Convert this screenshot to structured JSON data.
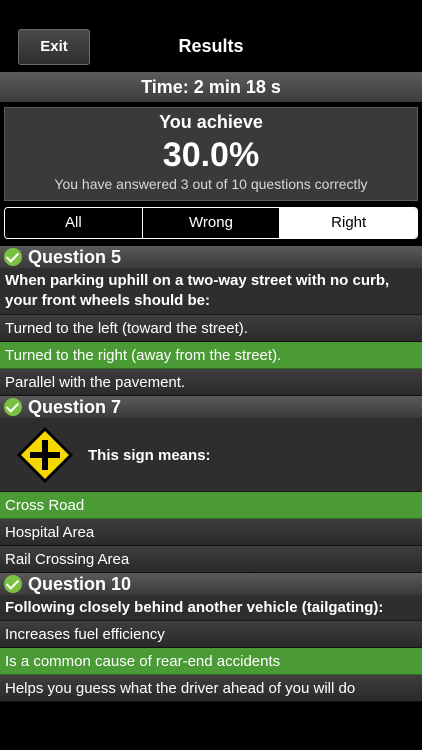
{
  "navbar": {
    "exit_label": "Exit",
    "title": "Results"
  },
  "time_label": "Time: 2 min 18 s",
  "score": {
    "label": "You achieve",
    "value": "30.0%",
    "detail": "You have answered 3 out of 10 questions correctly"
  },
  "filter": {
    "all": "All",
    "wrong": "Wrong",
    "right": "Right",
    "selected": "Right"
  },
  "questions": [
    {
      "title": "Question 5",
      "text": "When parking uphill on a two-way street with no curb, your front wheels should be:",
      "answers": [
        "Turned to the left (toward the street).",
        "Turned to the right (away from the street).",
        "Parallel with the pavement."
      ],
      "correct_index": 1
    },
    {
      "title": "Question 7",
      "text": "This sign means:",
      "image_icon": "crossroad-sign-icon",
      "answers": [
        "Cross Road",
        "Hospital Area",
        "Rail Crossing Area"
      ],
      "correct_index": 0
    },
    {
      "title": "Question 10",
      "text": "Following closely behind another vehicle (tailgating):",
      "answers": [
        "Increases fuel efficiency",
        "Is a common cause of rear-end accidents",
        "Helps you guess what the driver ahead of you will do"
      ],
      "correct_index": 1
    }
  ],
  "colors": {
    "correct": "#4a9a35",
    "check": "#7ac142",
    "sign_yellow": "#f5d800"
  }
}
